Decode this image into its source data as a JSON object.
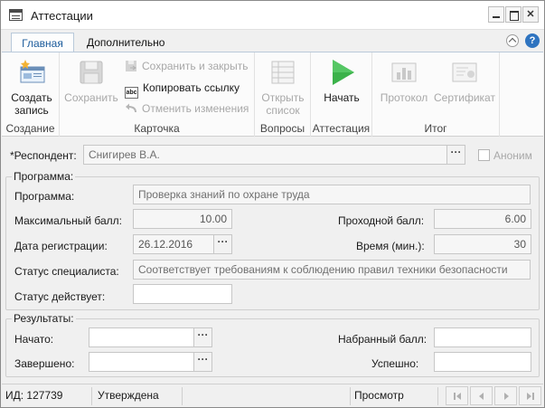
{
  "window": {
    "title": "Аттестации",
    "close_glyph": "✕"
  },
  "tabs": [
    {
      "label": "Главная",
      "active": true
    },
    {
      "label": "Дополнительно",
      "active": false
    }
  ],
  "help_glyph": "?",
  "ribbon": {
    "groups": {
      "create": {
        "label": "Создание",
        "create_record": {
          "line1": "Создать",
          "line2": "запись"
        }
      },
      "card": {
        "label": "Карточка",
        "save": "Сохранить",
        "save_close": "Сохранить и закрыть",
        "copy_link": "Копировать ссылку",
        "copy_link_icon_text": "abc",
        "undo": "Отменить изменения"
      },
      "questions": {
        "label": "Вопросы",
        "open_list": {
          "line1": "Открыть",
          "line2": "список"
        }
      },
      "attestation": {
        "label": "Аттестация",
        "start": "Начать"
      },
      "result": {
        "label": "Итог",
        "protocol": "Протокол",
        "certificate": "Сертификат"
      }
    }
  },
  "form": {
    "respondent": {
      "label": "*Респондент:",
      "value": "Снигирев В.А.",
      "dots": "···"
    },
    "anonymous": {
      "label": "Аноним",
      "checked": false
    },
    "program_section": {
      "legend": "Программа:",
      "program": {
        "label": "Программа:",
        "value": "Проверка знаний по охране труда"
      },
      "max_score": {
        "label": "Максимальный балл:",
        "value": "10.00"
      },
      "pass_score": {
        "label": "Проходной балл:",
        "value": "6.00"
      },
      "reg_date": {
        "label": "Дата регистрации:",
        "value": "26.12.2016",
        "dots": "···"
      },
      "time": {
        "label": "Время (мин.):",
        "value": "30"
      },
      "specialist_status": {
        "label": "Статус специалиста:",
        "value": "Соответствует требованиям к соблюдению правил техники безопасности"
      },
      "status_valid": {
        "label": "Статус действует:",
        "value": ""
      }
    },
    "results_section": {
      "legend": "Результаты:",
      "started": {
        "label": "Начато:",
        "value": "",
        "dots": "···"
      },
      "finished": {
        "label": "Завершено:",
        "value": "",
        "dots": "···"
      },
      "score": {
        "label": "Набранный балл:",
        "value": ""
      },
      "success": {
        "label": "Успешно:",
        "value": ""
      }
    }
  },
  "statusbar": {
    "id": "ИД: 127739",
    "state": "Утверждена",
    "mode": "Просмотр"
  },
  "colors": {
    "accent": "#1b5b9b",
    "start_green": "#3bb24a",
    "help_blue": "#2f74c0",
    "disabled_text": "#a8a8a8"
  }
}
